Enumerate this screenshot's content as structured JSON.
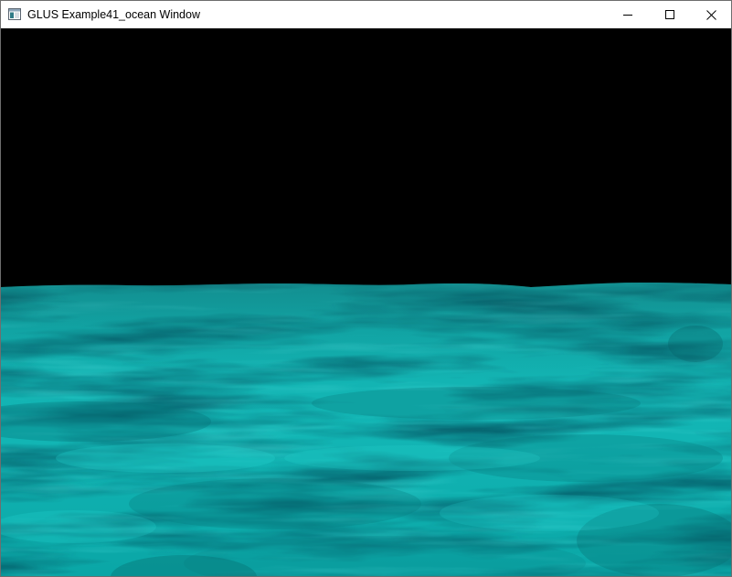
{
  "window": {
    "title": "GLUS Example41_ocean Window",
    "icon": "application-window-icon",
    "controls": [
      {
        "name": "minimize",
        "icon": "minimize-icon"
      },
      {
        "name": "maximize",
        "icon": "maximize-icon"
      },
      {
        "name": "close",
        "icon": "close-icon"
      }
    ]
  },
  "scene": {
    "description_visible": false,
    "sky_color": "#000000",
    "ocean_color": "#12b3b3",
    "ocean_dark_color": "#066e70",
    "ocean_light_color": "#20d2cf"
  }
}
